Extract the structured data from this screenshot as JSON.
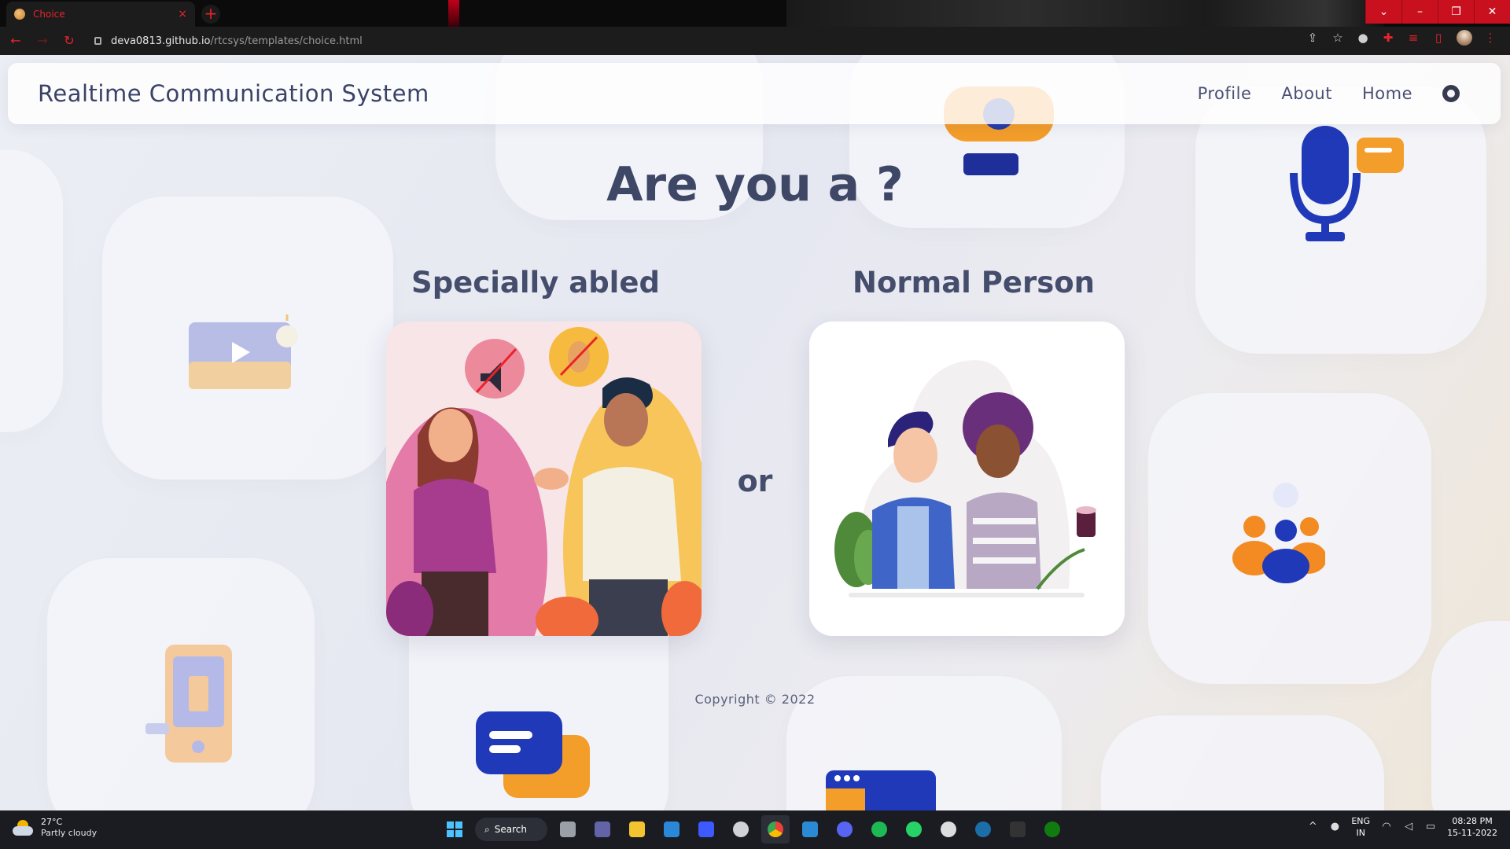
{
  "browser": {
    "tab": {
      "title": "Choice",
      "close": "×"
    },
    "new_tab": "+",
    "window_controls": [
      "⌄",
      "–",
      "❐",
      "✕"
    ],
    "nav": {
      "back": "←",
      "forward": "→",
      "reload": "↻"
    },
    "url": {
      "host": "deva0813.github.io",
      "path": "/rtcsys/templates/choice.html"
    },
    "toolbar_icons": [
      "share-icon",
      "star-icon",
      "extension-icon",
      "puzzle-icon",
      "media-icon",
      "sidepanel-icon",
      "profile-avatar",
      "menu-icon"
    ],
    "toolbar_glyphs": {
      "share": "⇪",
      "star": "☆",
      "ext1": "●",
      "puzzle": "✚",
      "media": "≡",
      "sidepanel": "▯",
      "menu": "⋮"
    }
  },
  "site": {
    "brand": "Realtime Communication System",
    "nav": [
      {
        "label": "Profile"
      },
      {
        "label": "About"
      },
      {
        "label": "Home"
      }
    ],
    "heading": "Are you a ?",
    "choices": {
      "left": {
        "label": "Specially abled"
      },
      "right": {
        "label": "Normal Person"
      }
    },
    "or": "or",
    "copyright": "Copyright © 2022"
  },
  "taskbar": {
    "weather": {
      "temp": "27°C",
      "condition": "Partly cloudy"
    },
    "search_label": "Search",
    "language": {
      "lang": "ENG",
      "region": "IN"
    },
    "clock": {
      "time": "08:28 PM",
      "date": "15-11-2022"
    },
    "apps": [
      "windows-start-icon",
      "search-button",
      "task-view-icon",
      "teams-icon",
      "file-explorer-icon",
      "store-icon",
      "affinity-icon",
      "unity-icon",
      "chrome-icon",
      "vscode-icon",
      "discord-icon",
      "spotify-icon",
      "whatsapp-icon",
      "obs-icon",
      "steam-icon",
      "epic-games-icon",
      "xbox-icon"
    ]
  },
  "colors": {
    "accent_red": "#e8232b",
    "heading_text": "#3e4766",
    "brand_text": "#3a4266"
  }
}
